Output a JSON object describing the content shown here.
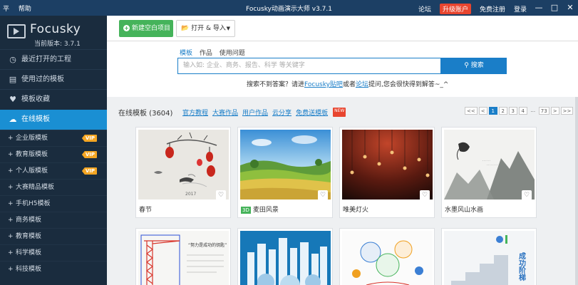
{
  "titlebar": {
    "menu": [
      "平",
      "帮助"
    ],
    "title": "Focusky动画演示大师 v3.7.1",
    "links": {
      "forum": "论坛",
      "upgrade": "升级账户",
      "register": "免费注册",
      "login": "登录"
    },
    "controls": {
      "minimize": "—",
      "maximize": "□",
      "close": "✕"
    }
  },
  "sidebar": {
    "logo": "Focusky",
    "version": "当前版本: 3.7.1",
    "items": [
      {
        "label": "最近打开的工程",
        "icon": "clock-icon"
      },
      {
        "label": "使用过的模板",
        "icon": "template-icon"
      },
      {
        "label": "模板收藏",
        "icon": "heart-icon"
      },
      {
        "label": "在线模板",
        "icon": "cloud-icon"
      }
    ],
    "sub_items": [
      {
        "label": "企业版模板",
        "vip": "VIP"
      },
      {
        "label": "教育版模板",
        "vip": "VIP"
      },
      {
        "label": "个人版模板",
        "vip": "VIP"
      },
      {
        "label": "大赛精品模板"
      },
      {
        "label": "手机H5模板"
      },
      {
        "label": "商务模板"
      },
      {
        "label": "教育模板"
      },
      {
        "label": "科学模板"
      },
      {
        "label": "科技模板"
      }
    ],
    "plus": "+"
  },
  "toolbar": {
    "new_project": "新建空白项目",
    "open_import": "打开 & 导入"
  },
  "search": {
    "tabs": [
      "模板",
      "作品",
      "使用问题"
    ],
    "placeholder": "输入如: 企业、商务、报告、科学 等关键字",
    "button": "搜索",
    "hint_before": "搜索不到答案？请进",
    "hint_link1": "Focusky贴吧",
    "hint_mid": "或者",
    "hint_link2": "论坛",
    "hint_after": "提问,您会很快得到解答~_^"
  },
  "content": {
    "heading": "在线模板 (3604)",
    "filters": [
      "官方教程",
      "大赛作品",
      "用户作品",
      "云分享",
      "免费送模板"
    ],
    "new_badge": "NEW",
    "pager": [
      "<<",
      "<",
      "1",
      "2",
      "3",
      "4",
      "...",
      "73",
      ">",
      ">>"
    ],
    "cards": [
      {
        "title": "春节",
        "badge": ""
      },
      {
        "title": "麦田风景",
        "badge": "3D"
      },
      {
        "title": "唯美灯火",
        "badge": ""
      },
      {
        "title": "水墨风山水画",
        "badge": ""
      }
    ],
    "thumb_text": {
      "spring_year": "2017",
      "power_title": "“努力是成功的钥匙”",
      "steps": "成功阶梯"
    }
  },
  "colors": {
    "titlebar": "#1c3f64",
    "sidebar": "#1a2c3e",
    "active": "#1a8fd3",
    "accent": "#1a7ec8",
    "green": "#45b35a",
    "vip": "#f5a623",
    "red": "#e8452f"
  }
}
